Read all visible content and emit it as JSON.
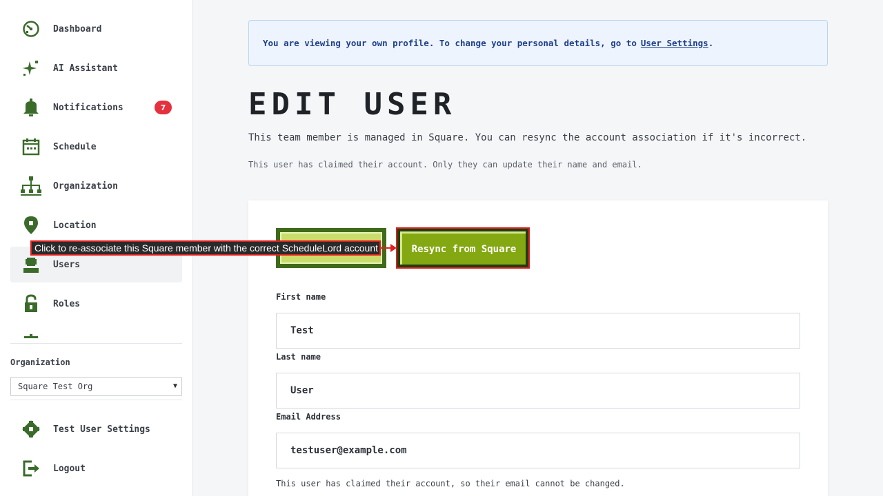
{
  "sidebar": {
    "items": [
      {
        "label": "Dashboard",
        "icon": "dashboard-icon"
      },
      {
        "label": "AI Assistant",
        "icon": "sparkle-icon"
      },
      {
        "label": "Notifications",
        "icon": "bell-icon",
        "badge": "7"
      },
      {
        "label": "Schedule",
        "icon": "calendar-icon"
      },
      {
        "label": "Organization",
        "icon": "org-chart-icon"
      },
      {
        "label": "Location",
        "icon": "map-pin-icon"
      },
      {
        "label": "Users",
        "icon": "user-icon",
        "active": true
      },
      {
        "label": "Roles",
        "icon": "lock-icon"
      }
    ],
    "organization_label": "Organization",
    "organization_selected": "Square Test Org",
    "bottom_items": [
      {
        "label": "Test User Settings",
        "icon": "gear-icon"
      },
      {
        "label": "Logout",
        "icon": "logout-icon"
      }
    ]
  },
  "tooltip": {
    "text": "Click to re-associate this Square member with the correct ScheduleLord account"
  },
  "banner": {
    "text": "You are viewing your own profile. To change your personal details, go to",
    "link": "User Settings",
    "suffix": "."
  },
  "page": {
    "title": "EDIT USER",
    "subtitle": "This team member is managed in Square. You can resync the account association if it's incorrect.",
    "note": "This user has claimed their account. Only they can update their name and email."
  },
  "actions": {
    "resync_label": "Resync from Square"
  },
  "form": {
    "first_name_label": "First name",
    "first_name_value": "Test",
    "last_name_label": "Last name",
    "last_name_value": "User",
    "email_label": "Email Address",
    "email_value": "testuser@example.com",
    "email_help": "This user has claimed their account, so their email cannot be changed."
  },
  "colors": {
    "icon_green": "#3a6b2a",
    "badge_red": "#e5303e",
    "button_green": "#84a811",
    "highlight_red": "#e02020"
  }
}
